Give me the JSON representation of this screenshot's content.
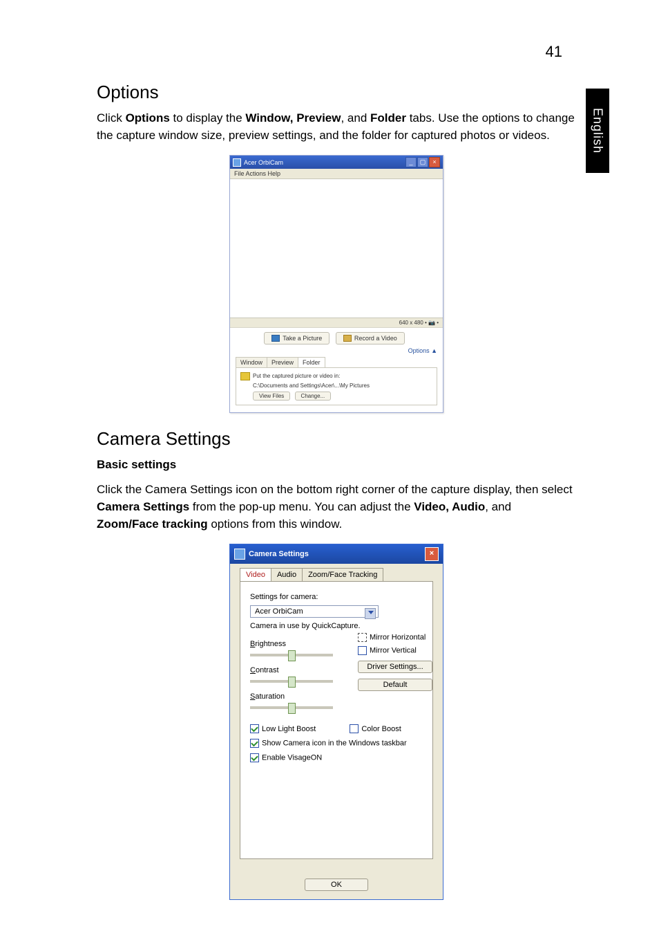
{
  "page_number": "41",
  "side_tab": "English",
  "sections": {
    "options_title": "Options",
    "options_body_pre": "Click ",
    "options_b1": "Options",
    "options_mid1": " to display the ",
    "options_b2": "Window, Preview",
    "options_mid2": ", and ",
    "options_b3": "Folder",
    "options_tail": " tabs. Use the options to change the capture window size, preview settings, and the folder for captured photos or videos.",
    "camera_settings_title": "Camera Settings",
    "basic_settings": "Basic settings",
    "basic_p_pre": "Click the Camera Settings icon on the bottom right corner of the capture display, then select ",
    "basic_b1": "Camera Settings",
    "basic_mid1": " from the pop-up menu. You can adjust the ",
    "basic_b2": "Video, Audio",
    "basic_mid2": ", and ",
    "basic_b3": "Zoom/Face tracking",
    "basic_tail": " options from this window."
  },
  "orbicam": {
    "title": "Acer OrbiCam",
    "menu": "File   Actions   Help",
    "status": "640 x 480 •   📷 •",
    "take_picture": "Take a Picture",
    "record_video": "Record a Video",
    "options_link": "Options  ▲",
    "tabs": {
      "window": "Window",
      "preview": "Preview",
      "folder": "Folder"
    },
    "panel_line1": "Put the captured picture or video in:",
    "panel_line2": "C:\\Documents and Settings\\Acer\\...\\My Pictures",
    "view_files": "View Files",
    "change": "Change..."
  },
  "cs": {
    "title": "Camera Settings",
    "tabs": {
      "video": "Video",
      "audio": "Audio",
      "zoom": "Zoom/Face Tracking"
    },
    "settings_for": "Settings for camera:",
    "camera_name": "Acer OrbiCam",
    "in_use": "Camera in use by QuickCapture.",
    "brightness": "Brightness",
    "contrast": "Contrast",
    "saturation": "Saturation",
    "mirror_h": "Mirror Horizontal",
    "mirror_v": "Mirror Vertical",
    "driver_settings": "Driver Settings...",
    "default": "Default",
    "low_light": "Low Light Boost",
    "color_boost": "Color Boost",
    "show_taskbar": "Show Camera icon in the Windows taskbar",
    "enable_visage": "Enable VisageON",
    "ok": "OK"
  },
  "chart_data": null
}
